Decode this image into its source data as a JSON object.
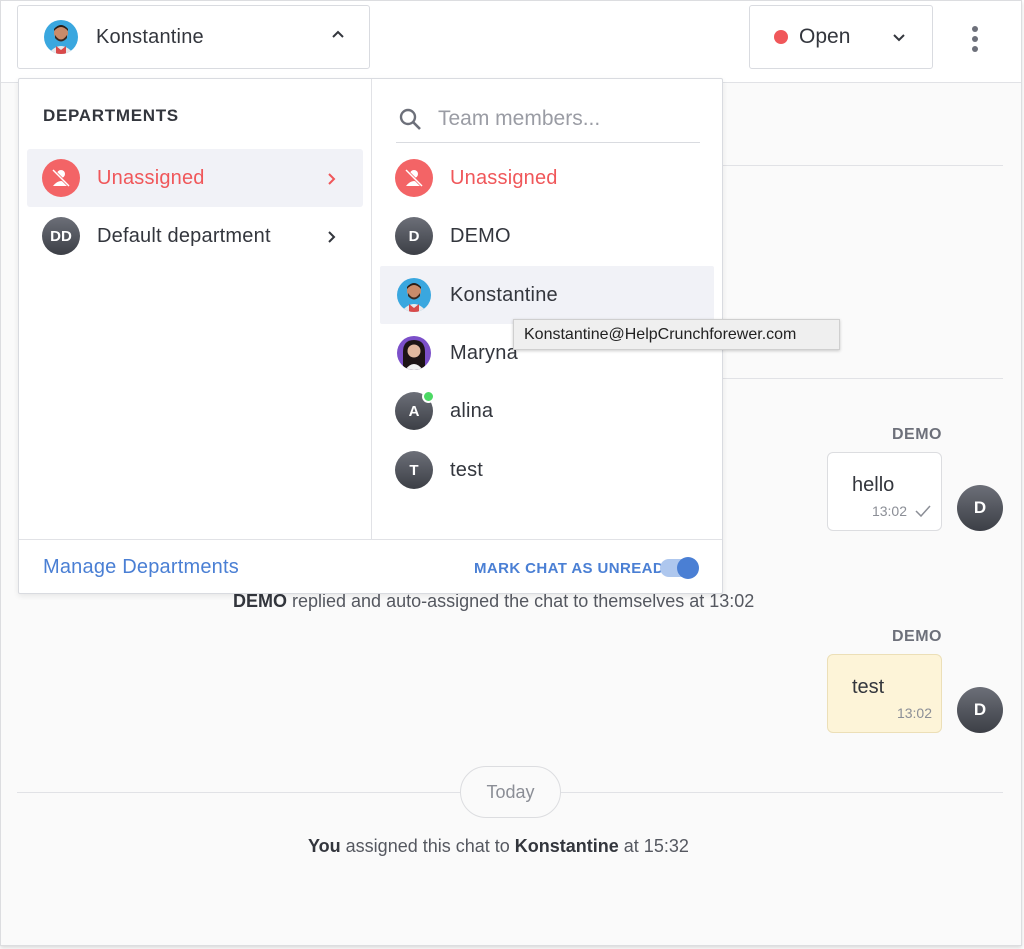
{
  "header": {
    "assignee": {
      "name": "Konstantine",
      "avatar_icon": "user-photo-konstantine",
      "chevron_icon": "chevron-up-icon"
    },
    "status": {
      "label": "Open",
      "color": "#f0575a",
      "chevron_icon": "chevron-down-icon"
    },
    "more_icon": "more-vertical-icon"
  },
  "dropdown": {
    "departments_heading": "DEPARTMENTS",
    "departments": [
      {
        "label": "Unassigned",
        "avatar": "unassigned-icon",
        "active": true
      },
      {
        "label": "Default department",
        "initials": "DD",
        "active": false
      }
    ],
    "search": {
      "placeholder": "Team members..."
    },
    "members": [
      {
        "label": "Unassigned",
        "avatar": "unassigned-icon"
      },
      {
        "label": "DEMO",
        "initials": "D"
      },
      {
        "label": "Konstantine",
        "avatar": "user-photo-konstantine"
      },
      {
        "label": "Maryna",
        "avatar": "user-photo-maryna"
      },
      {
        "label": "alina",
        "initials": "A",
        "online": true
      },
      {
        "label": "test",
        "initials": "T"
      }
    ],
    "tooltip": "Konstantine@HelpCrunchforewer.com",
    "footer": {
      "manage_link": "Manage Departments",
      "mark_unread_label": "MARK CHAT AS UNREAD",
      "mark_unread_on": true
    }
  },
  "chat": {
    "messages": [
      {
        "sender": "DEMO",
        "text": "hello",
        "time": "13:02",
        "avatar_initial": "D",
        "read_icon": "check-icon"
      },
      {
        "sender": "DEMO",
        "text": "test",
        "time": "13:02",
        "avatar_initial": "D"
      }
    ],
    "system_1": {
      "actor": "DEMO",
      "text": " replied and auto-assigned the chat to themselves at 13:02"
    },
    "date_divider": "Today",
    "system_2": {
      "actor": "You",
      "middle": " assigned this chat to ",
      "target": "Konstantine",
      "end": " at 15:32"
    }
  }
}
